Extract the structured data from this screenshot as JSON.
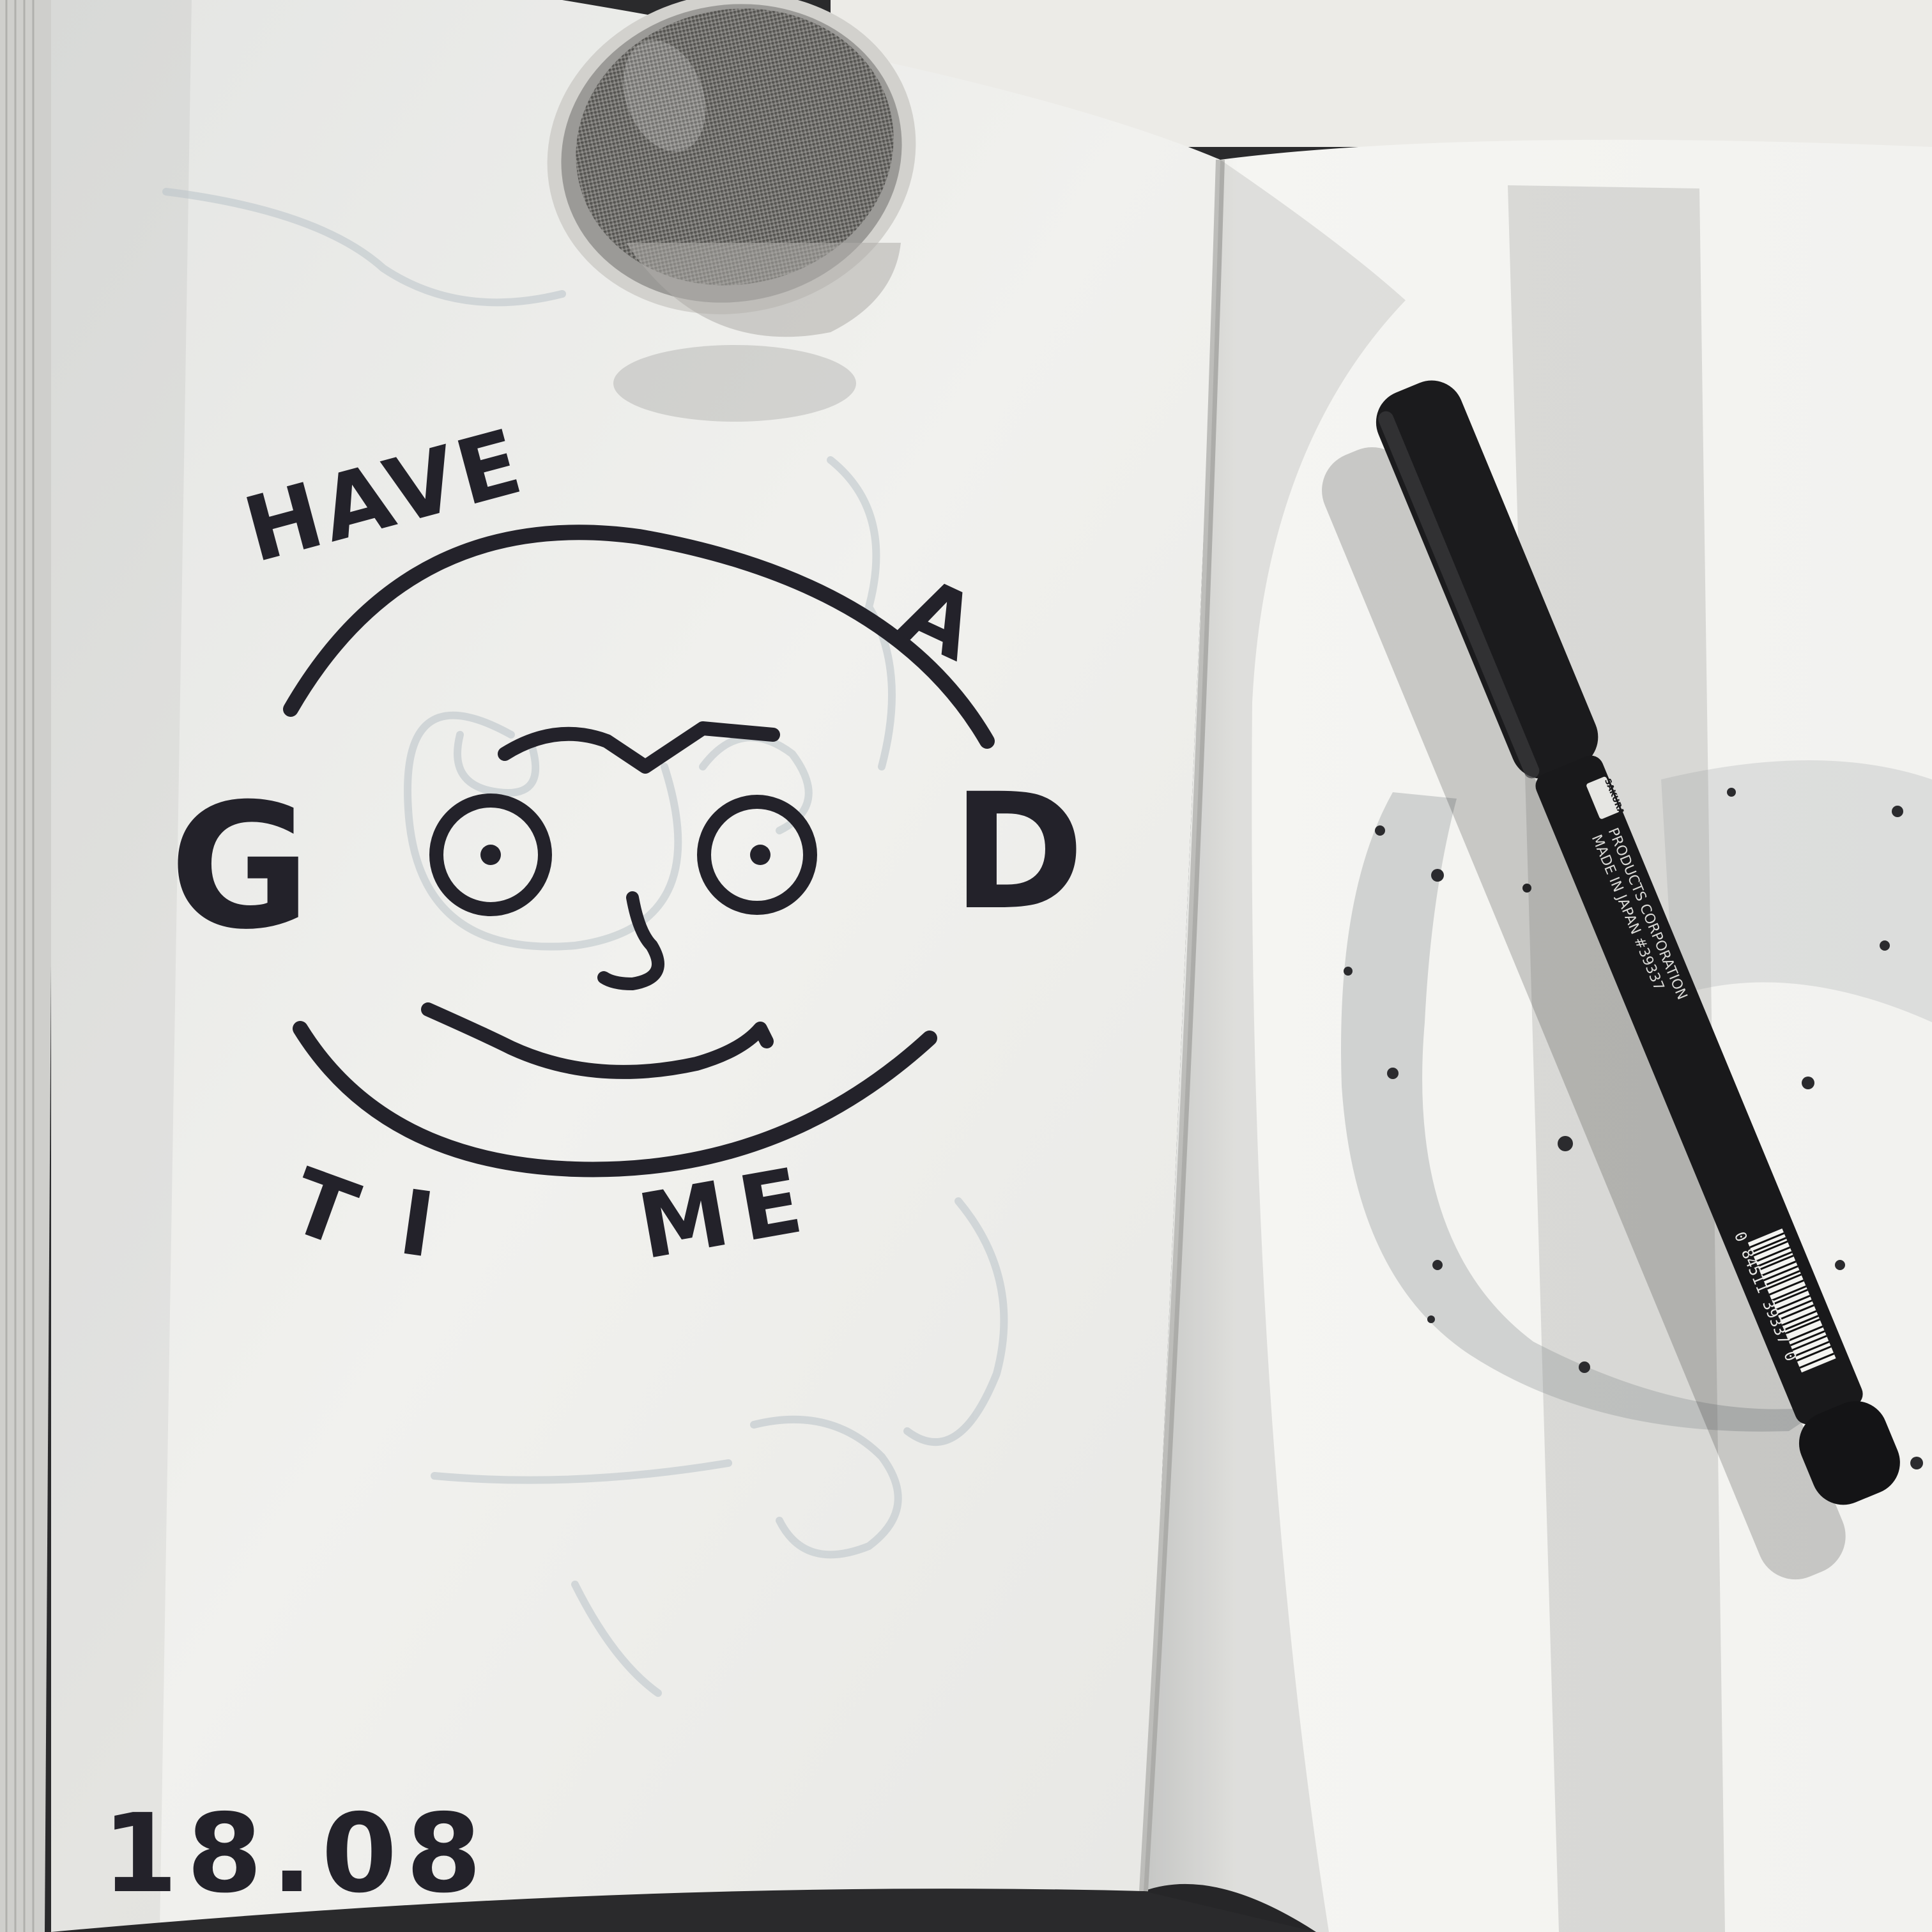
{
  "lettering": {
    "have": "HAVE",
    "a": "A",
    "good_g": "G",
    "good_d": "D",
    "time_t": "T",
    "time_i": "I",
    "time_me": "ME"
  },
  "date": "18.08",
  "pen": {
    "brand": "SAKURA",
    "imprint_line1": "PRODUCTS CORPORATION",
    "imprint_line2": "MADE IN JAPAN #39337",
    "barcode_digits": "0 84511 39337 0"
  },
  "colors": {
    "background_table": "#2a2a2c",
    "paper_lit": "#f4f4f1",
    "paper_shadow": "#dcdcdb",
    "ink": "#23222a",
    "pen_body": "#1b1b1d",
    "tea_infuser_metal": "#b9b8b4"
  }
}
